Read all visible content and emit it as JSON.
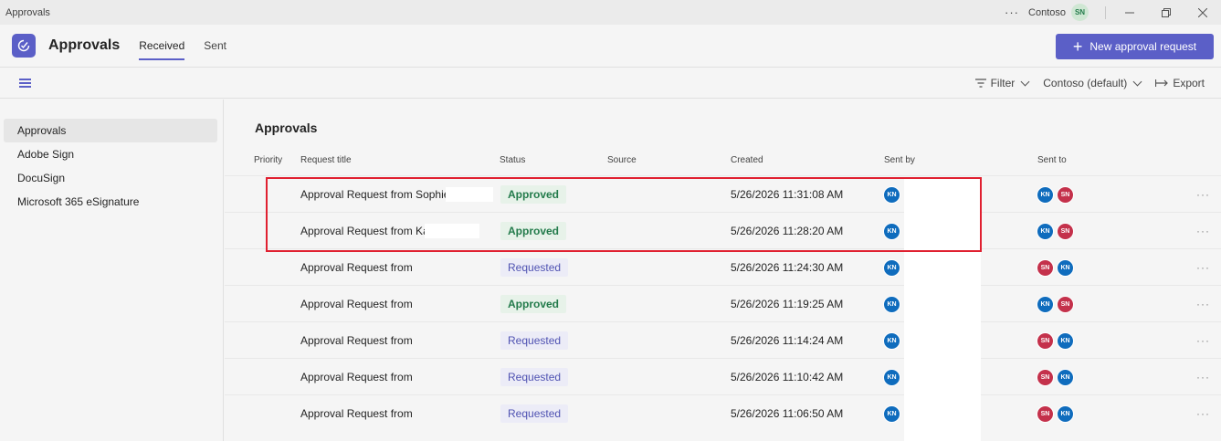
{
  "titlebar": {
    "app_name": "Approvals",
    "more": "···",
    "org": "Contoso",
    "user_initials": "SN"
  },
  "header": {
    "title": "Approvals",
    "tabs": [
      {
        "label": "Received",
        "active": true
      },
      {
        "label": "Sent",
        "active": false
      }
    ],
    "new_button": "New approval request"
  },
  "toolbar": {
    "filter": "Filter",
    "org_select": "Contoso (default)",
    "export": "Export"
  },
  "sidebar": {
    "items": [
      {
        "label": "Approvals",
        "active": true
      },
      {
        "label": "Adobe Sign",
        "active": false
      },
      {
        "label": "DocuSign",
        "active": false
      },
      {
        "label": "Microsoft 365 eSignature",
        "active": false
      }
    ]
  },
  "main": {
    "title": "Approvals",
    "columns": [
      "Priority",
      "Request title",
      "Status",
      "Source",
      "Created",
      "Sent by",
      "Sent to"
    ],
    "rows": [
      {
        "title": "Approval Request from Sophie",
        "status": "Approved",
        "created": "5/26/2026 11:31:08 AM",
        "sent_by": "KN",
        "sent_to": [
          "KN",
          "SN"
        ]
      },
      {
        "title": "Approval Request from Ka",
        "status": "Approved",
        "created": "5/26/2026 11:28:20 AM",
        "sent_by": "KN",
        "sent_to": [
          "KN",
          "SN"
        ]
      },
      {
        "title": "Approval Request from",
        "status": "Requested",
        "created": "5/26/2026 11:24:30 AM",
        "sent_by": "KN",
        "sent_to": [
          "SN",
          "KN"
        ]
      },
      {
        "title": "Approval Request from",
        "status": "Approved",
        "created": "5/26/2026 11:19:25 AM",
        "sent_by": "KN",
        "sent_to": [
          "KN",
          "SN"
        ]
      },
      {
        "title": "Approval Request from",
        "status": "Requested",
        "created": "5/26/2026 11:14:24 AM",
        "sent_by": "KN",
        "sent_to": [
          "SN",
          "KN"
        ]
      },
      {
        "title": "Approval Request from",
        "status": "Requested",
        "created": "5/26/2026 11:10:42 AM",
        "sent_by": "KN",
        "sent_to": [
          "SN",
          "KN"
        ]
      },
      {
        "title": "Approval Request from",
        "status": "Requested",
        "created": "5/26/2026 11:06:50 AM",
        "sent_by": "KN",
        "sent_to": [
          "SN",
          "KN"
        ]
      }
    ],
    "row_more": "···"
  },
  "colors": {
    "brand": "#5b5fc7",
    "approved": "#237b4b",
    "requested": "#4f52b2",
    "kn_avatar": "#0f6cbd",
    "sn_avatar": "#c4314b",
    "highlight": "#e02030"
  }
}
